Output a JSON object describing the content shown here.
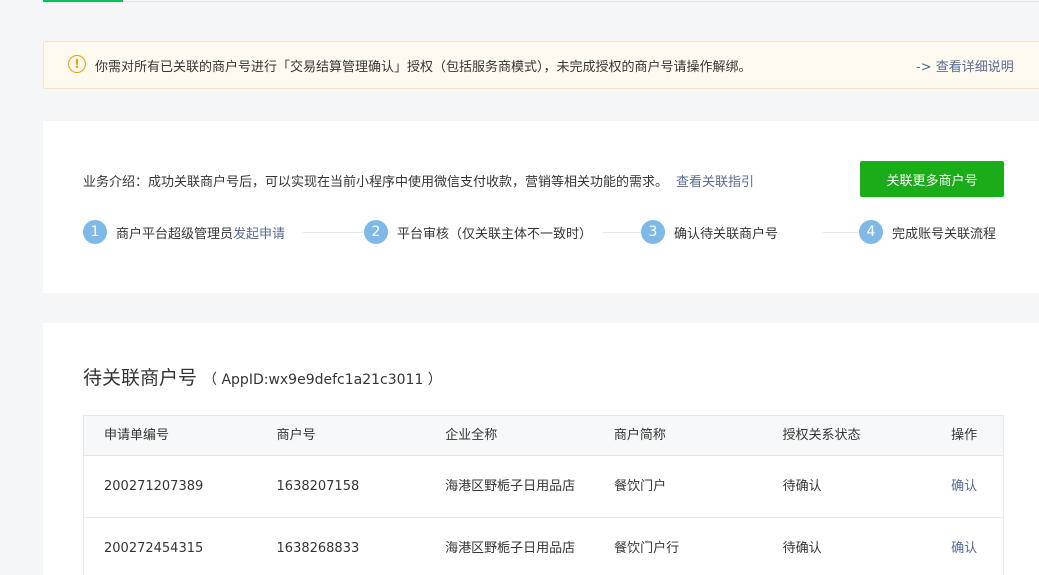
{
  "notice": {
    "text": "你需对所有已关联的商户号进行「交易结算管理确认」授权（包括服务商模式），未完成授权的商户号请操作解绑。",
    "link": "-> 查看详细说明",
    "icon": "warning-icon",
    "color": "#f2a000"
  },
  "intro": {
    "text": "业务介绍：成功关联商户号后，可以实现在当前小程序中使用微信支付收款，营销等相关功能的需求。",
    "link": "查看关联指引"
  },
  "primary_button": {
    "label": "关联更多商户号",
    "color": "#1aad19"
  },
  "steps": [
    {
      "num": "1",
      "label": "商户平台超级管理员",
      "link": "发起申请"
    },
    {
      "num": "2",
      "label": "平台审核（仅关联主体不一致时）"
    },
    {
      "num": "3",
      "label": "确认待关联商户号"
    },
    {
      "num": "4",
      "label": "完成账号关联流程"
    }
  ],
  "section": {
    "title": "待关联商户号",
    "appid": "（ AppID:wx9e9defc1a21c3011 ）"
  },
  "table": {
    "headers": [
      "申请单编号",
      "商户号",
      "企业全称",
      "商户简称",
      "授权关系状态",
      "操作"
    ],
    "rows": [
      {
        "order_no": "200271207389",
        "merchant_no": "1638207158",
        "company": "海港区野栀子日用品店",
        "short_name": "餐饮门户",
        "status": "待确认",
        "action": "确认"
      },
      {
        "order_no": "200272454315",
        "merchant_no": "1638268833",
        "company": "海港区野栀子日用品店",
        "short_name": "餐饮门户行",
        "status": "待确认",
        "action": "确认"
      }
    ]
  }
}
